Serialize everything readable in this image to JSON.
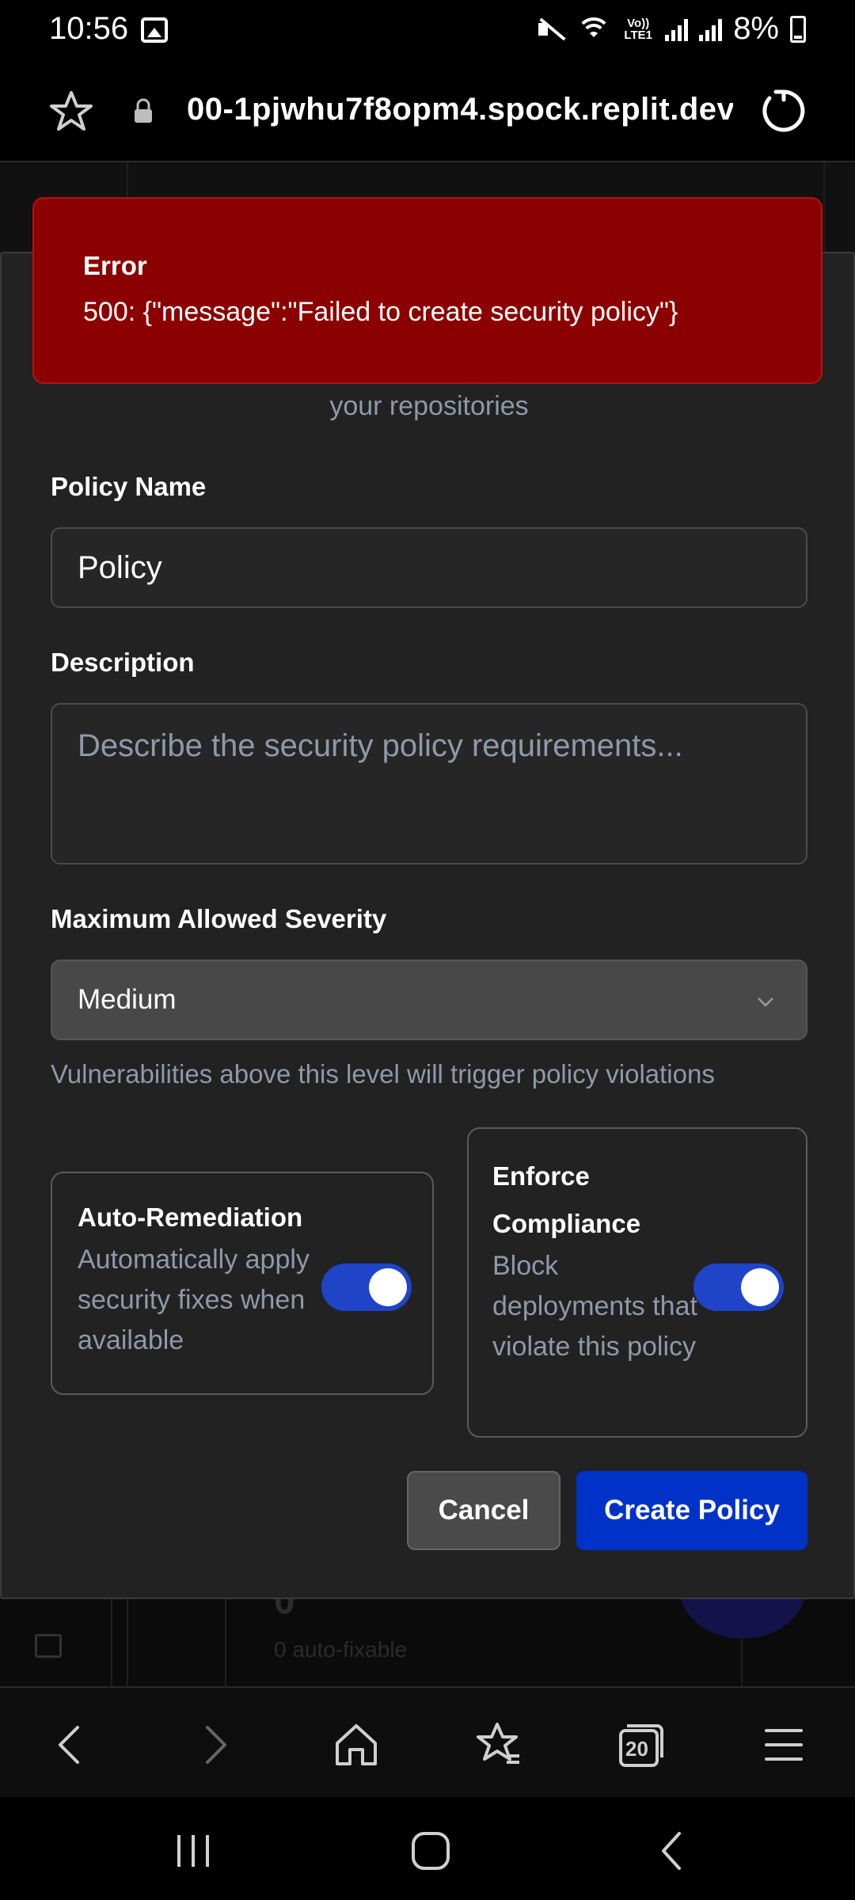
{
  "status_bar": {
    "time": "10:56",
    "battery": "8%",
    "volte": "Vo))\nLTE1",
    "icons": [
      "gallery-icon",
      "mute-icon",
      "wifi-icon",
      "volte-icon",
      "signal-icon",
      "signal-r-icon",
      "battery-charging-icon"
    ]
  },
  "browser": {
    "url": "00-1pjwhu7f8opm4.spock.replit.dev",
    "tabs_count": "20"
  },
  "background": {
    "count_value": "0",
    "count_caption": "0 auto-fixable"
  },
  "toast": {
    "title": "Error",
    "message": "500: {\"message\":\"Failed to create security policy\"}"
  },
  "modal": {
    "subtitle": "your repositories",
    "policy_name_label": "Policy Name",
    "policy_name_value": "Policy",
    "description_label": "Description",
    "description_placeholder": "Describe the security policy requirements...",
    "severity_label": "Maximum Allowed Severity",
    "severity_value": "Medium",
    "severity_help": "Vulnerabilities above this level will trigger policy violations",
    "auto_remediation": {
      "title": "Auto-Remediation",
      "description": "Automatically apply security fixes when available",
      "enabled": true
    },
    "enforce_compliance": {
      "title": "Enforce Compliance",
      "description": "Block deployments that violate this policy",
      "enabled": true
    },
    "cancel_label": "Cancel",
    "create_label": "Create Policy"
  },
  "colors": {
    "toast_bg": "#8b0000",
    "primary": "#0032c8",
    "toggle_on": "#1f44c8",
    "muted_text": "#8e99aa",
    "modal_bg": "#222222"
  }
}
